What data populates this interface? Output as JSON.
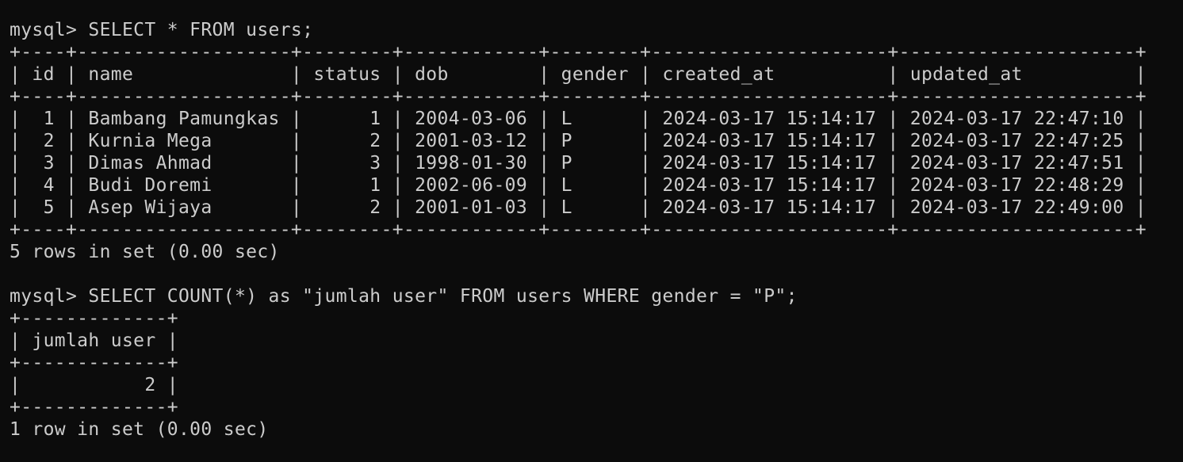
{
  "theme": {
    "background": "#0c0c0c",
    "foreground": "#cccccc"
  },
  "terminal": {
    "lines": [
      "mysql> SELECT * FROM users;",
      "+----+-------------------+--------+------------+--------+---------------------+---------------------+",
      "| id | name              | status | dob        | gender | created_at          | updated_at          |",
      "+----+-------------------+--------+------------+--------+---------------------+---------------------+",
      "|  1 | Bambang Pamungkas |      1 | 2004-03-06 | L      | 2024-03-17 15:14:17 | 2024-03-17 22:47:10 |",
      "|  2 | Kurnia Mega       |      2 | 2001-03-12 | P      | 2024-03-17 15:14:17 | 2024-03-17 22:47:25 |",
      "|  3 | Dimas Ahmad       |      3 | 1998-01-30 | P      | 2024-03-17 15:14:17 | 2024-03-17 22:47:51 |",
      "|  4 | Budi Doremi       |      1 | 2002-06-09 | L      | 2024-03-17 15:14:17 | 2024-03-17 22:48:29 |",
      "|  5 | Asep Wijaya       |      2 | 2001-01-03 | L      | 2024-03-17 15:14:17 | 2024-03-17 22:49:00 |",
      "+----+-------------------+--------+------------+--------+---------------------+---------------------+",
      "5 rows in set (0.00 sec)",
      "",
      "mysql> SELECT COUNT(*) as \"jumlah user\" FROM users WHERE gender = \"P\";",
      "+-------------+",
      "| jumlah user |",
      "+-------------+",
      "|           2 |",
      "+-------------+",
      "1 row in set (0.00 sec)"
    ]
  }
}
